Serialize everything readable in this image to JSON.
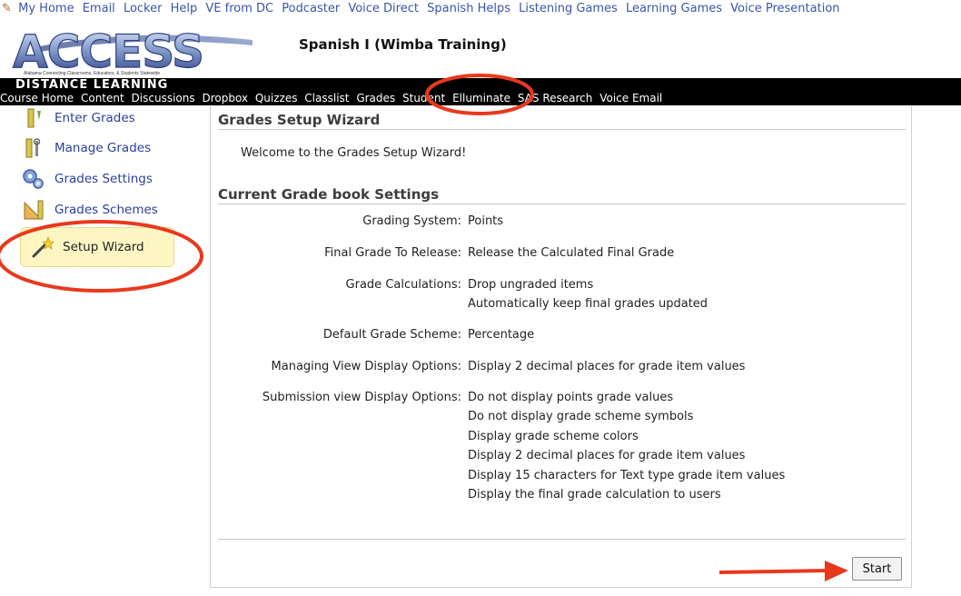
{
  "top_links": [
    "My Home",
    "Email",
    "Locker",
    "Help",
    "VE from DC",
    "Podcaster",
    "Voice Direct",
    "Spanish Helps",
    "Listening Games",
    "Learning Games",
    "Voice Presentation"
  ],
  "logo": {
    "text": "ACCESS",
    "tagline": "Alabama Connecting Classrooms, Educators, & Students Statewide"
  },
  "course_title": "Spanish I (Wimba Training)",
  "distance_learning": "DISTANCE LEARNING",
  "course_nav": [
    "Course Home",
    "Content",
    "Discussions",
    "Dropbox",
    "Quizzes",
    "Classlist",
    "Grades",
    "Student",
    "Elluminate",
    "SAS Research",
    "Voice Email"
  ],
  "sidebar": {
    "items": [
      {
        "label": "Enter Grades",
        "icon": "ruler-pencil-icon"
      },
      {
        "label": "Manage Grades",
        "icon": "ruler-wrench-icon"
      },
      {
        "label": "Grades Settings",
        "icon": "gears-icon"
      },
      {
        "label": "Grades Schemes",
        "icon": "triangle-ruler-icon"
      },
      {
        "label": "Setup Wizard",
        "icon": "magic-wand-icon"
      }
    ]
  },
  "main": {
    "title": "Grades Setup Wizard",
    "welcome": "Welcome to the Grades Setup Wizard!",
    "settings_title": "Current Grade book Settings",
    "settings": [
      {
        "label": "Grading System:",
        "values": [
          "Points"
        ]
      },
      {
        "label": "Final Grade To Release:",
        "values": [
          "Release the Calculated Final Grade"
        ]
      },
      {
        "label": "Grade Calculations:",
        "values": [
          "Drop ungraded items",
          "Automatically keep final grades updated"
        ]
      },
      {
        "label": "Default Grade Scheme:",
        "values": [
          "Percentage"
        ]
      },
      {
        "label": "Managing View Display Options:",
        "values": [
          "Display 2 decimal places for grade item values"
        ]
      },
      {
        "label": "Submission view Display Options:",
        "values": [
          "Do not display points grade values",
          "Do not display grade scheme symbols",
          "Display grade scheme colors",
          "Display 2 decimal places for grade item values",
          "Display 15 characters for Text type grade item values",
          "Display the final grade calculation to users"
        ]
      }
    ],
    "start_label": "Start"
  },
  "colors": {
    "link": "#3a55a8",
    "annotation": "#e8391d",
    "navbar_bg": "#000000",
    "active_bg": "#fdf6c3"
  }
}
